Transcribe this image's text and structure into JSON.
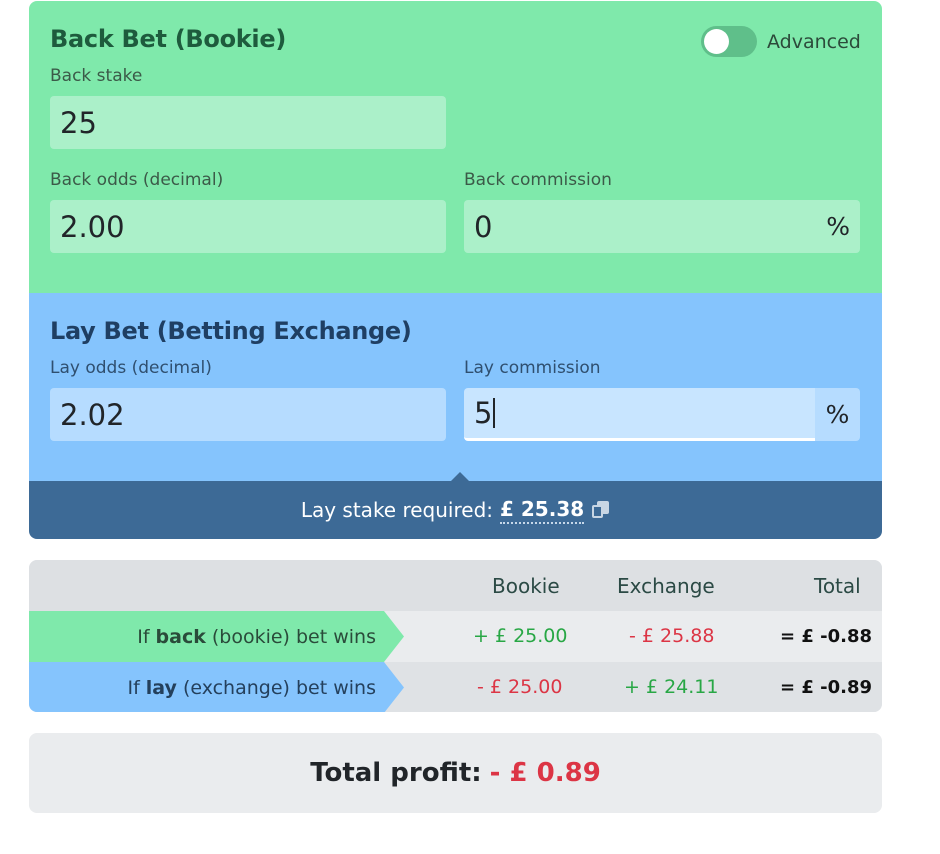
{
  "back": {
    "title": "Back Bet (Bookie)",
    "advanced_label": "Advanced",
    "stake_label": "Back stake",
    "stake_value": "25",
    "odds_label": "Back odds (decimal)",
    "odds_value": "2.00",
    "commission_label": "Back commission",
    "commission_value": "0",
    "percent": "%"
  },
  "lay": {
    "title": "Lay Bet (Betting Exchange)",
    "odds_label": "Lay odds (decimal)",
    "odds_value": "2.02",
    "commission_label": "Lay commission",
    "commission_value": "5",
    "percent": "%"
  },
  "stake": {
    "label": "Lay stake required:",
    "value": "£ 25.38"
  },
  "results": {
    "headers": [
      "Bookie",
      "Exchange",
      "Total"
    ],
    "rows": [
      {
        "prefix": "If",
        "bold": "back",
        "suffix": "(bookie) bet wins",
        "bookie": "+ £ 25.00",
        "exchange": "- £ 25.88",
        "total": "= £ -0.88"
      },
      {
        "prefix": "If",
        "bold": "lay",
        "suffix": "(exchange) bet wins",
        "bookie": "- £ 25.00",
        "exchange": "+ £ 24.11",
        "total": "= £ -0.89"
      }
    ]
  },
  "profit": {
    "label": "Total profit:",
    "value": "- £ 0.89"
  },
  "colors": {
    "back_bg": "#7fe9ab",
    "lay_bg": "#85c4fd",
    "stake_bar": "#3d6a96",
    "positive": "#28a745",
    "negative": "#dc3545"
  },
  "icons": [
    "toggle-switch",
    "copy-icon"
  ]
}
